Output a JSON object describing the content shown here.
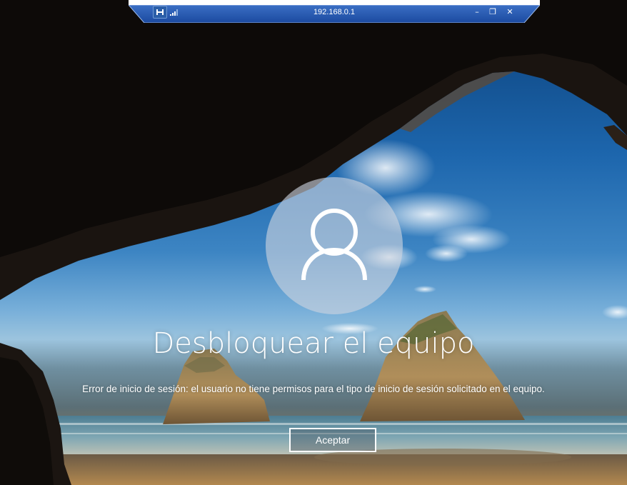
{
  "rdp_bar": {
    "host": "192.168.0.1",
    "pin_icon": "pin-icon",
    "signal_icon": "connection-signal-icon",
    "minimize_label": "–",
    "restore_label": "❐",
    "close_label": "✕"
  },
  "lock_screen": {
    "avatar_icon": "user-icon",
    "title": "Desbloquear el equipo",
    "message": "Error de inicio de sesión: el usuario no tiene permisos para el tipo de inicio de sesión solicitado en el equipo.",
    "accept_label": "Aceptar"
  }
}
